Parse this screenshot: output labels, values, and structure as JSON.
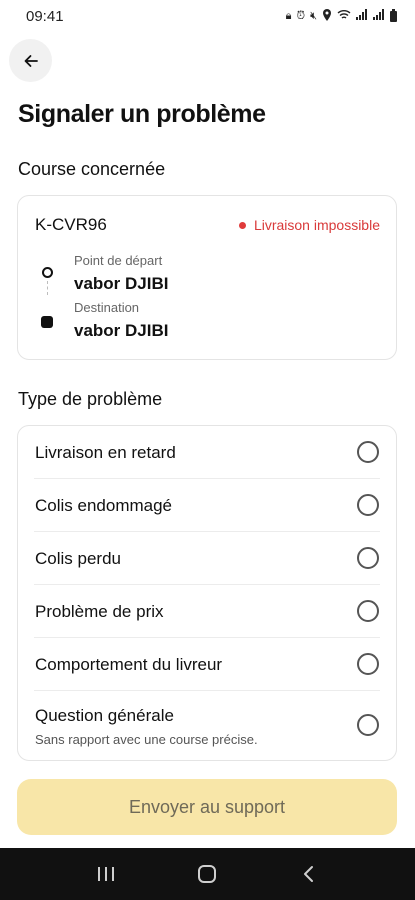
{
  "status_bar": {
    "time": "09:41"
  },
  "header": {
    "back_icon": "arrow-left-icon",
    "title": "Signaler un problème"
  },
  "course_section": {
    "title": "Course concernée",
    "course_id": "K-CVR96",
    "status": "Livraison impossible",
    "status_color": "#d93a3a",
    "departure_label": "Point de départ",
    "departure_value": "vabor DJIBI",
    "destination_label": "Destination",
    "destination_value": "vabor DJIBI"
  },
  "problem_section": {
    "title": "Type de problème",
    "options": [
      {
        "label": "Livraison en retard"
      },
      {
        "label": "Colis endommagé"
      },
      {
        "label": "Colis perdu"
      },
      {
        "label": "Problème de prix"
      },
      {
        "label": "Comportement du livreur"
      },
      {
        "label": "Question générale",
        "sub": "Sans rapport avec une course précise."
      }
    ]
  },
  "submit": {
    "label": "Envoyer au support",
    "bg_color": "#f8e6a8"
  },
  "nav_bar": {
    "icons": [
      "recent-apps-icon",
      "home-icon",
      "back-icon"
    ]
  }
}
